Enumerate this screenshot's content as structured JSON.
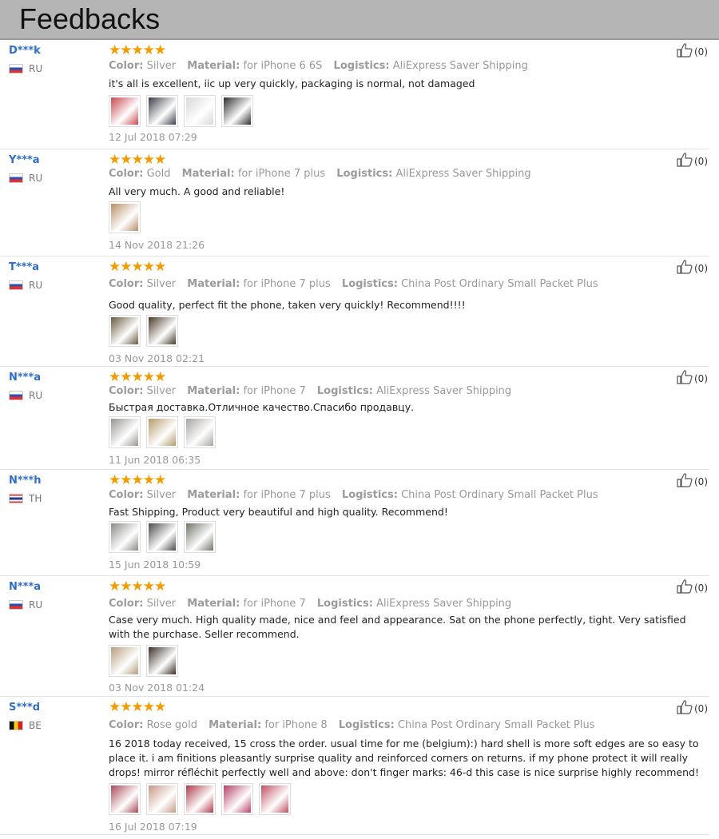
{
  "header": {
    "title": "Feedbacks"
  },
  "labels": {
    "color": "Color:",
    "material": "Material:",
    "logistics": "Logistics:",
    "stars": "★★★★★"
  },
  "reviews": [
    {
      "user": "D***k",
      "country": "RU",
      "flag": "ru",
      "color": "Silver",
      "material": "for iPhone 6 6S",
      "logistics": "AliExpress Saver Shipping",
      "comment": "it's all is excellent, iic up very quickly, packaging is normal, not damaged",
      "date": "12 Jul 2018 07:29",
      "likes": "(0)",
      "photos": [
        "#c9474f",
        "#3a3f48",
        "#d8d8d8",
        "#2e2e2e"
      ]
    },
    {
      "user": "Y***a",
      "country": "RU",
      "flag": "ru",
      "color": "Gold",
      "material": "for iPhone 7 plus",
      "logistics": "AliExpress Saver Shipping",
      "comment": "All very much. A good and reliable!",
      "date": "14 Nov 2018 21:26",
      "likes": "(0)",
      "photos": [
        "#b98e66"
      ]
    },
    {
      "user": "T***a",
      "country": "RU",
      "flag": "ru",
      "color": "Silver",
      "material": "for iPhone 7 plus",
      "logistics": "China Post Ordinary Small Packet Plus",
      "comment": "Good quality, perfect fit the phone, taken very quickly! Recommend!!!!",
      "date": "03 Nov 2018 02:21",
      "likes": "(0)",
      "photos": [
        "#6b5a3e",
        "#4a3a28"
      ]
    },
    {
      "user": "N***a",
      "country": "RU",
      "flag": "ru",
      "color": "Silver",
      "material": "for iPhone 7",
      "logistics": "AliExpress Saver Shipping",
      "comment": "Быстрая доставка.Отличное качество.Спасибо продавцу.",
      "date": "11 Jun 2018 06:35",
      "likes": "(0)",
      "photos": [
        "#9a9590",
        "#b59a6a",
        "#a8a39e"
      ]
    },
    {
      "user": "N***h",
      "country": "TH",
      "flag": "th",
      "color": "Silver",
      "material": "for iPhone 7 plus",
      "logistics": "China Post Ordinary Small Packet Plus",
      "comment": "Fast Shipping, Product very beautiful and high quality. Recommend!",
      "date": "15 Jun 2018 10:59",
      "likes": "(0)",
      "photos": [
        "#8a8a86",
        "#4a4a4a",
        "#6f7468"
      ]
    },
    {
      "user": "N***a",
      "country": "RU",
      "flag": "ru",
      "color": "Silver",
      "material": "for iPhone 7",
      "logistics": "AliExpress Saver Shipping",
      "comment": "Case very much. High quality made, nice and feel and appearance. Sat on the phone perfectly, tight. Very satisfied with the purchase. Seller recommend.",
      "date": "03 Nov 2018 01:24",
      "likes": "(0)",
      "photos": [
        "#b59e7e",
        "#3b3028"
      ]
    },
    {
      "user": "S***d",
      "country": "BE",
      "flag": "be",
      "color": "Rose gold",
      "material": "for iPhone 8",
      "logistics": "China Post Ordinary Small Packet Plus",
      "comment": "16 2018 today received, 15 cross the order. usual time for me (belgium):) hard shell is more soft edges are so easy to place it. i am finitions pleasantly surprise quality and reinforced corners on returns. if my phone protect it will really drops! mirror réfléchit perfectly well and above: don't finger marks: 46-d this case is nice surprise highly recommend!",
      "date": "16 Jul 2018 07:19",
      "likes": "(0)",
      "photos": [
        "#a84a58",
        "#c79a86",
        "#b03a4a",
        "#b5406a",
        "#c05060"
      ]
    }
  ]
}
